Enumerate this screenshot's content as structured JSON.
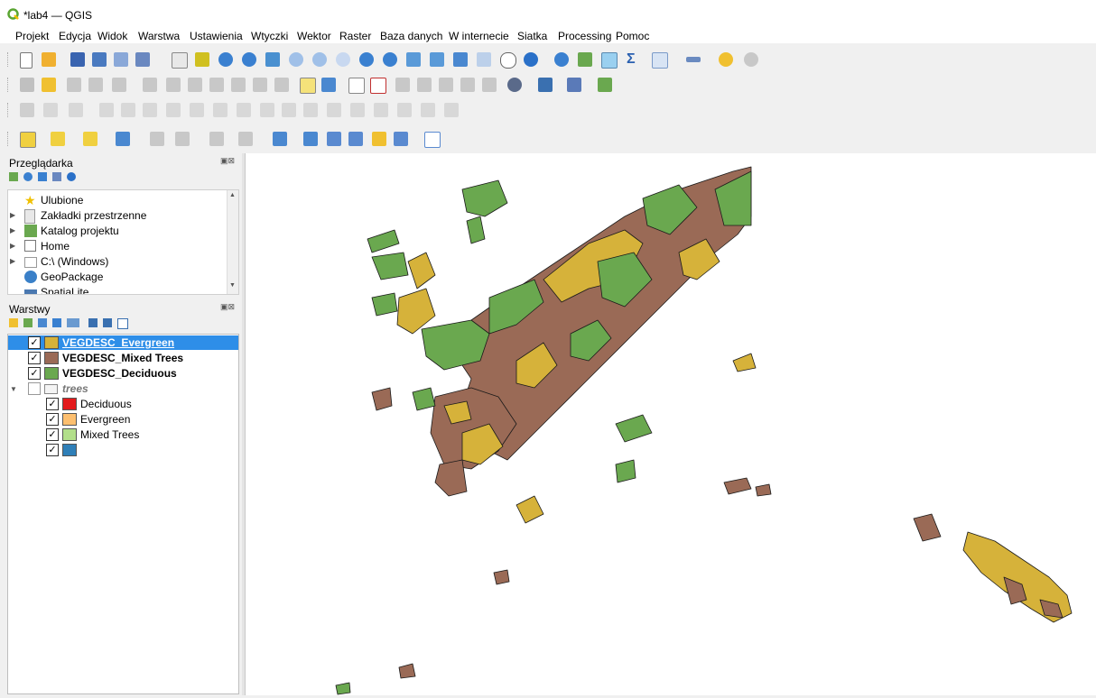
{
  "window": {
    "title": "*lab4 — QGIS"
  },
  "menu": [
    "Projekt",
    "Edycja",
    "Widok",
    "Warstwa",
    "Ustawienia",
    "Wtyczki",
    "Wektor",
    "Raster",
    "Baza danych",
    "W internecie",
    "Siatka",
    "Processing",
    "Pomoc"
  ],
  "browser": {
    "title": "Przeglądarka",
    "items": [
      {
        "label": "Ulubione",
        "icon": "star-icon"
      },
      {
        "label": "Zakładki przestrzenne",
        "icon": "bookmark-icon"
      },
      {
        "label": "Katalog projektu",
        "icon": "project-folder-icon"
      },
      {
        "label": "Home",
        "icon": "home-icon"
      },
      {
        "label": "C:\\ (Windows)",
        "icon": "drive-icon"
      },
      {
        "label": "GeoPackage",
        "icon": "geopackage-icon"
      },
      {
        "label": "SpatiaLite",
        "icon": "spatialite-icon"
      }
    ]
  },
  "layers": {
    "title": "Warstwy",
    "items": [
      {
        "label": "VEGDESC_Evergreen",
        "color": "#d6b23a",
        "checked": true,
        "selected": true
      },
      {
        "label": "VEGDESC_Mixed Trees",
        "color": "#9a6a56",
        "checked": true,
        "selected": false
      },
      {
        "label": "VEGDESC_Deciduous",
        "color": "#6aa84f",
        "checked": true,
        "selected": false
      }
    ],
    "group": {
      "label": "trees",
      "checked": false,
      "classes": [
        {
          "label": "Deciduous",
          "color": "#e31a1c"
        },
        {
          "label": "Evergreen",
          "color": "#fdbf6f"
        },
        {
          "label": "Mixed Trees",
          "color": "#b2df8a"
        },
        {
          "label": "",
          "color": "#2f7fb8"
        }
      ]
    }
  },
  "colors": {
    "selection": "#2e8ee8",
    "evergreen": "#d6b23a",
    "mixed": "#9a6a56",
    "deciduous": "#6aa84f"
  }
}
